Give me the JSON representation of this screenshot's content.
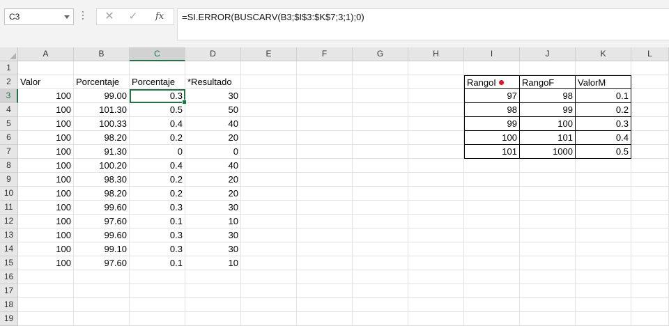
{
  "formula_bar": {
    "name_box": "C3",
    "fx_label": "fx",
    "cancel_glyph": "✕",
    "enter_glyph": "✓",
    "formula": "=SI.ERROR(BUSCARV(B3;$I$3:$K$7;3;1);0)"
  },
  "columns": [
    "A",
    "B",
    "C",
    "D",
    "E",
    "F",
    "G",
    "H",
    "I",
    "J",
    "K",
    "L"
  ],
  "rows": [
    "1",
    "2",
    "3",
    "4",
    "5",
    "6",
    "7",
    "8",
    "9",
    "10",
    "11",
    "12",
    "13",
    "14",
    "15",
    "16",
    "17",
    "18",
    "19"
  ],
  "selected_cell": "C3",
  "headers_row2": {
    "A": "Valor",
    "B": "Porcentaje",
    "C": "Porcentaje",
    "D": "*Resultado"
  },
  "data_rows": [
    {
      "A": "100",
      "B": "99.00",
      "C": "0.3",
      "D": "30"
    },
    {
      "A": "100",
      "B": "101.30",
      "C": "0.5",
      "D": "50"
    },
    {
      "A": "100",
      "B": "100.33",
      "C": "0.4",
      "D": "40"
    },
    {
      "A": "100",
      "B": "98.20",
      "C": "0.2",
      "D": "20"
    },
    {
      "A": "100",
      "B": "91.30",
      "C": "0",
      "D": "0"
    },
    {
      "A": "100",
      "B": "100.20",
      "C": "0.4",
      "D": "40"
    },
    {
      "A": "100",
      "B": "98.30",
      "C": "0.2",
      "D": "20"
    },
    {
      "A": "100",
      "B": "98.20",
      "C": "0.2",
      "D": "20"
    },
    {
      "A": "100",
      "B": "99.60",
      "C": "0.3",
      "D": "30"
    },
    {
      "A": "100",
      "B": "97.60",
      "C": "0.1",
      "D": "10"
    },
    {
      "A": "100",
      "B": "99.60",
      "C": "0.3",
      "D": "30"
    },
    {
      "A": "100",
      "B": "99.10",
      "C": "0.3",
      "D": "30"
    },
    {
      "A": "100",
      "B": "97.60",
      "C": "0.1",
      "D": "10"
    }
  ],
  "lookup_table": {
    "headers": {
      "I": "RangoI",
      "J": "RangoF",
      "K": "ValorM"
    },
    "rows": [
      {
        "I": "97",
        "J": "98",
        "K": "0.1"
      },
      {
        "I": "98",
        "J": "99",
        "K": "0.2"
      },
      {
        "I": "99",
        "J": "100",
        "K": "0.3"
      },
      {
        "I": "100",
        "J": "101",
        "K": "0.4"
      },
      {
        "I": "101",
        "J": "1000",
        "K": "0.5"
      }
    ],
    "marker_color": "#e81123"
  },
  "colors": {
    "accent": "#217346"
  }
}
